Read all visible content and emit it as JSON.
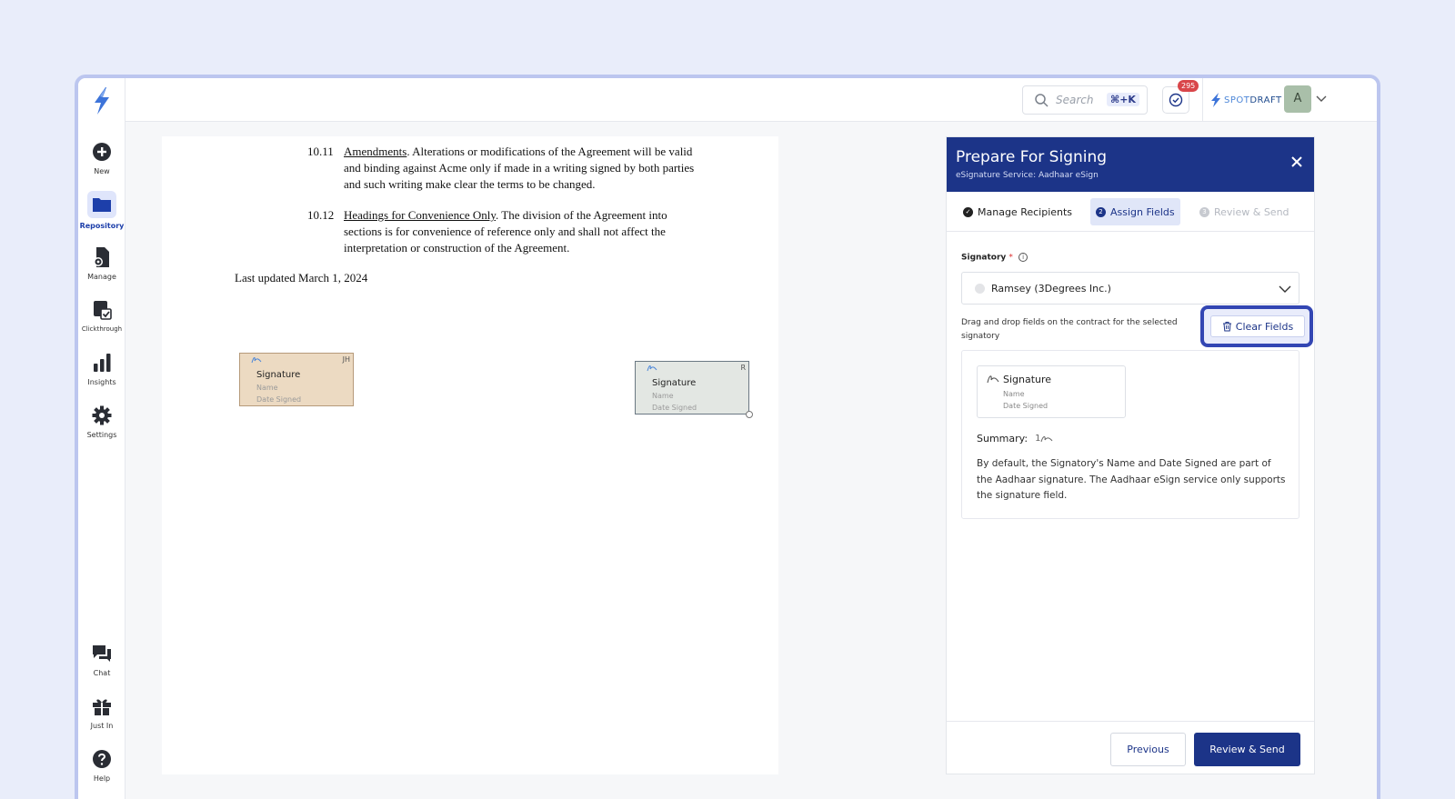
{
  "sidebar": {
    "items": [
      {
        "label": "New"
      },
      {
        "label": "Repository"
      },
      {
        "label": "Manage"
      },
      {
        "label": "Clickthrough"
      },
      {
        "label": "Insights"
      },
      {
        "label": "Settings"
      },
      {
        "label": "Chat"
      },
      {
        "label": "Just In"
      },
      {
        "label": "Help"
      }
    ]
  },
  "topbar": {
    "search_placeholder": "Search",
    "search_shortcut": "⌘+K",
    "tasks_count": "295",
    "brand_spot": "SPOT",
    "brand_draft": "DRAFT",
    "avatar_initial": "A"
  },
  "document": {
    "clauses": [
      {
        "num": "10.11",
        "heading": "Amendments",
        "body": ". Alterations or modifications of the Agreement will be valid and binding against Acme only if made in a writing signed by both parties and such writing make clear the terms to be changed."
      },
      {
        "num": "10.12",
        "heading": "Headings for Convenience Only",
        "body": ". The division of the Agreement into sections is for convenience of reference only and shall not affect the interpretation or construction of the Agreement."
      }
    ],
    "last_updated": "Last updated March 1, 2024",
    "signature_fields": [
      {
        "tag": "JH",
        "title": "Signature",
        "name": "Name",
        "date": "Date Signed",
        "color": "#ecdac2"
      },
      {
        "tag": "R",
        "title": "Signature",
        "name": "Name",
        "date": "Date Signed",
        "color": "#e3e7e3"
      }
    ]
  },
  "panel": {
    "title": "Prepare For Signing",
    "subtitle": "eSignature Service: Aadhaar eSign",
    "tabs": [
      {
        "label": "Manage Recipients",
        "state": "done"
      },
      {
        "label": "Assign Fields",
        "step": "2",
        "state": "active"
      },
      {
        "label": "Review & Send",
        "step": "3",
        "state": "disabled"
      }
    ],
    "signatory_label": "Signatory",
    "signatory_value": "Ramsey (3Degrees Inc.)",
    "hint": "Drag and drop fields on the contract for the selected signatory",
    "clear_fields_label": "Clear Fields",
    "field_card": {
      "title": "Signature",
      "name": "Name",
      "date": "Date Signed"
    },
    "summary_label": "Summary:",
    "summary_count": "1",
    "description": "By default, the Signatory's Name and Date Signed are part of the Aadhaar signature. The Aadhaar eSign service only supports the signature field.",
    "previous_label": "Previous",
    "next_label": "Review & Send"
  },
  "colors": {
    "primary": "#1c3488",
    "badge": "#d9464a",
    "highlight_ring": "#3346b3"
  }
}
